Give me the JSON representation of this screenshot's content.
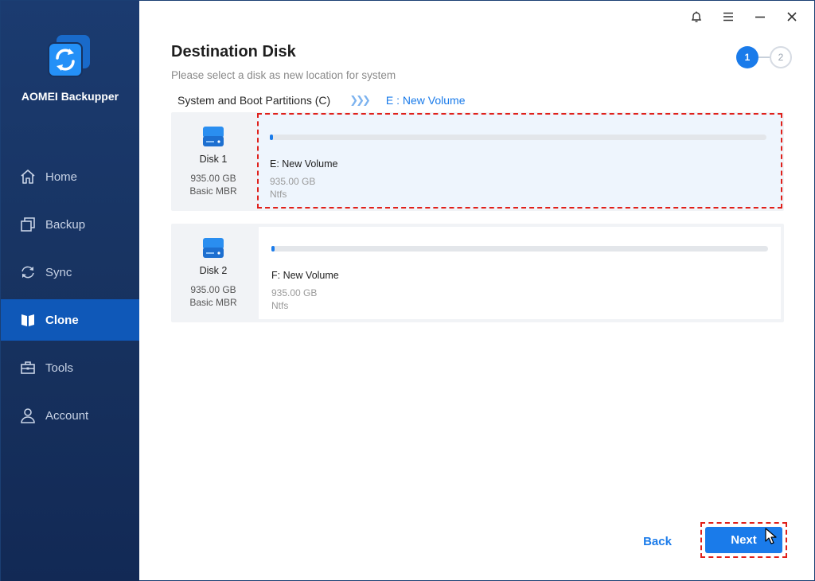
{
  "app": {
    "name": "AOMEI Backupper",
    "brand_color": "#1a7bea",
    "sidebar_color": "#17325f",
    "highlight_color": "#e0201a"
  },
  "window_controls": [
    {
      "icon": "bell-icon"
    },
    {
      "icon": "menu-icon"
    },
    {
      "icon": "minimize-icon"
    },
    {
      "icon": "close-icon"
    }
  ],
  "sidebar": {
    "items": [
      {
        "label": "Home",
        "icon": "home-icon",
        "active": false
      },
      {
        "label": "Backup",
        "icon": "backup-icon",
        "active": false
      },
      {
        "label": "Sync",
        "icon": "sync-icon",
        "active": false
      },
      {
        "label": "Clone",
        "icon": "clone-icon",
        "active": true
      },
      {
        "label": "Tools",
        "icon": "tools-icon",
        "active": false
      },
      {
        "label": "Account",
        "icon": "account-icon",
        "active": false
      }
    ]
  },
  "page": {
    "title": "Destination Disk",
    "subtitle": "Please select a disk as new location for system",
    "steps": {
      "current": "1",
      "next": "2"
    },
    "crumb": {
      "source": "System and Boot Partitions (C)",
      "destination": "E : New Volume"
    }
  },
  "disks": [
    {
      "name": "Disk 1",
      "size": "935.00 GB",
      "type": "Basic MBR",
      "partition": {
        "name": "E: New Volume",
        "size": "935.00 GB",
        "fs": "Ntfs",
        "used_fraction": 0.005,
        "selected": true
      }
    },
    {
      "name": "Disk 2",
      "size": "935.00 GB",
      "type": "Basic MBR",
      "partition": {
        "name": "F: New Volume",
        "size": "935.00 GB",
        "fs": "Ntfs",
        "used_fraction": 0.005,
        "selected": false
      }
    }
  ],
  "footer": {
    "back_label": "Back",
    "next_label": "Next"
  }
}
